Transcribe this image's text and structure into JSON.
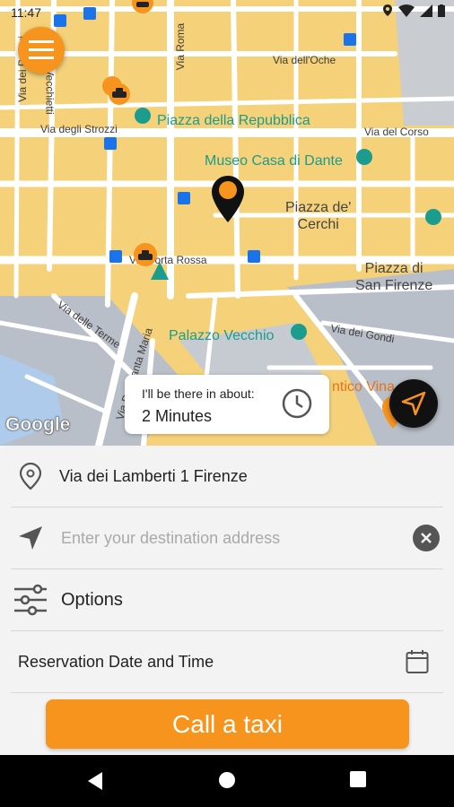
{
  "status_bar": {
    "time": "11:47"
  },
  "map": {
    "places": {
      "piazza_repubblica": "Piazza della Repubblica",
      "museo_dante": "Museo Casa di Dante",
      "palazzo_vecchio": "Palazzo Vecchio",
      "antico_vinaio": "ntico Vina"
    },
    "areas": {
      "piazza_cerchi": [
        "Piazza de'",
        "Cerchi"
      ],
      "piazza_san_firenze": [
        "Piazza di",
        "San Firenze"
      ]
    },
    "streets": {
      "pecori": "Via dei Pecori",
      "vecchietti": "Vecchietti",
      "roma": "Via Roma",
      "oche": "Via dell'Oche",
      "strozzi": "Via degli Strozzi",
      "corso": "Via del Corso",
      "porta_rossa": "Via Porta Rossa",
      "terme": "Via delle Terme",
      "gondi": "Via dei Gondi",
      "maggio": "Via Por Santa Maria"
    },
    "attribution": "Google"
  },
  "eta": {
    "label": "I'll be there in about:",
    "value": "2 Minutes"
  },
  "pickup": {
    "address": "Via dei Lamberti 1 Firenze"
  },
  "destination": {
    "placeholder": "Enter your destination address",
    "value": ""
  },
  "options": {
    "label": "Options"
  },
  "reservation": {
    "label": "Reservation Date and Time"
  },
  "call_button": {
    "label": "Call a taxi"
  },
  "colors": {
    "accent": "#f7941d",
    "map_block": "#f5d27a",
    "poi": "#1b9c8c",
    "transit": "#1a73e8"
  },
  "icons": [
    "menu-icon",
    "taxi-icon",
    "location-pin-icon",
    "navigation-arrow-icon",
    "clock-icon",
    "clear-icon",
    "sliders-icon",
    "calendar-icon",
    "back-icon",
    "home-icon",
    "recents-icon"
  ]
}
